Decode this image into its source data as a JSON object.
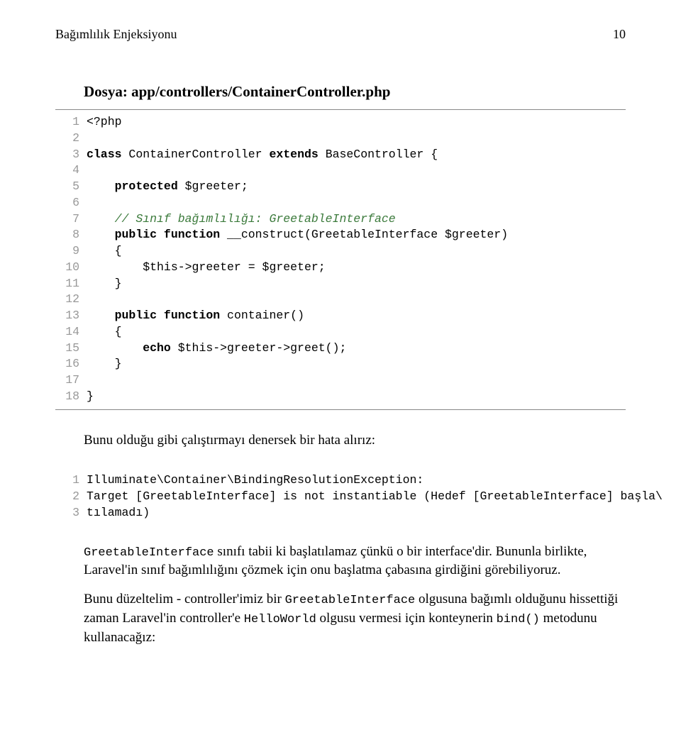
{
  "header": {
    "chapter": "Bağımlılık Enjeksiyonu",
    "page": "10"
  },
  "file_heading": "Dosya: app/controllers/ContainerController.php",
  "code1": {
    "lines": [
      {
        "n": "1",
        "frags": [
          {
            "t": "<?php",
            "c": ""
          }
        ]
      },
      {
        "n": "2",
        "frags": []
      },
      {
        "n": "3",
        "frags": [
          {
            "t": "class ",
            "c": "kw"
          },
          {
            "t": "ContainerController ",
            "c": ""
          },
          {
            "t": "extends ",
            "c": "kw"
          },
          {
            "t": "BaseController {",
            "c": ""
          }
        ]
      },
      {
        "n": "4",
        "frags": []
      },
      {
        "n": "5",
        "frags": [
          {
            "t": "    ",
            "c": ""
          },
          {
            "t": "protected ",
            "c": "kw"
          },
          {
            "t": "$greeter;",
            "c": ""
          }
        ]
      },
      {
        "n": "6",
        "frags": []
      },
      {
        "n": "7",
        "frags": [
          {
            "t": "    ",
            "c": ""
          },
          {
            "t": "// Sınıf bağımlılığı: GreetableInterface",
            "c": "cmt"
          }
        ]
      },
      {
        "n": "8",
        "frags": [
          {
            "t": "    ",
            "c": ""
          },
          {
            "t": "public function ",
            "c": "kw"
          },
          {
            "t": "__construct(GreetableInterface $greeter)",
            "c": ""
          }
        ]
      },
      {
        "n": "9",
        "frags": [
          {
            "t": "    {",
            "c": ""
          }
        ]
      },
      {
        "n": "10",
        "frags": [
          {
            "t": "        $this->greeter = $greeter;",
            "c": ""
          }
        ]
      },
      {
        "n": "11",
        "frags": [
          {
            "t": "    }",
            "c": ""
          }
        ]
      },
      {
        "n": "12",
        "frags": []
      },
      {
        "n": "13",
        "frags": [
          {
            "t": "    ",
            "c": ""
          },
          {
            "t": "public function ",
            "c": "kw"
          },
          {
            "t": "container()",
            "c": ""
          }
        ]
      },
      {
        "n": "14",
        "frags": [
          {
            "t": "    {",
            "c": ""
          }
        ]
      },
      {
        "n": "15",
        "frags": [
          {
            "t": "        ",
            "c": ""
          },
          {
            "t": "echo ",
            "c": "kw"
          },
          {
            "t": "$this->greeter->greet();",
            "c": ""
          }
        ]
      },
      {
        "n": "16",
        "frags": [
          {
            "t": "    }",
            "c": ""
          }
        ]
      },
      {
        "n": "17",
        "frags": []
      },
      {
        "n": "18",
        "frags": [
          {
            "t": "}",
            "c": ""
          }
        ]
      }
    ]
  },
  "para_after_code1": "Bunu olduğu gibi çalıştırmayı denersek bir hata alırız:",
  "code2": {
    "lines": [
      {
        "n": "1",
        "frags": [
          {
            "t": "Illuminate\\Container\\BindingResolutionException:",
            "c": ""
          }
        ]
      },
      {
        "n": "2",
        "frags": [
          {
            "t": "Target [GreetableInterface] is not instantiable (Hedef [GreetableInterface] başla\\",
            "c": ""
          }
        ]
      },
      {
        "n": "3",
        "frags": [
          {
            "t": "tılamadı)",
            "c": ""
          }
        ]
      }
    ]
  },
  "para2": {
    "seg1": "GreetableInterface",
    "seg2": " sınıfı tabii ki başlatılamaz çünkü o bir interface'dir. Bununla birlikte, Laravel'in sınıf bağımlılığını çözmek için onu başlatma çabasına girdiğini görebiliyoruz."
  },
  "para3": {
    "seg1": "Bunu düzeltelim - controller'imiz bir ",
    "seg2": "GreetableInterface",
    "seg3": " olgusuna bağımlı olduğunu hissettiği zaman Laravel'in controller'e ",
    "seg4": "HelloWorld",
    "seg5": " olgusu vermesi için konteynerin ",
    "seg6": "bind()",
    "seg7": " metodunu kullanacağız:"
  }
}
